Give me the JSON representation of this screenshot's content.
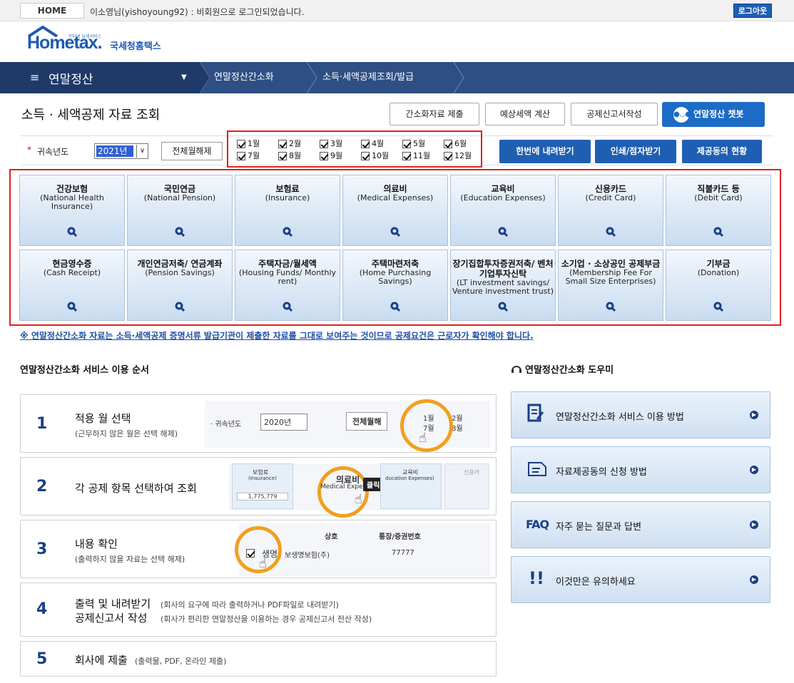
{
  "topbar": {
    "home": "HOME",
    "user_message": "이소영님(yishoyoung92) : 비회원으로 로그인되었습니다.",
    "logout": "로그아웃"
  },
  "logo": {
    "brand": "Hometax.",
    "tagline": "인터넷 납세서비스",
    "name_kr": "국세청홈택스"
  },
  "nav": {
    "menu_icon": "≡",
    "main": "연말정산",
    "crumbs": [
      "연말정산간소화",
      "소득·세액공제조회/발급"
    ]
  },
  "page": {
    "title": "소득 · 세액공제 자료 조회"
  },
  "toolbar": {
    "submit_simple": "간소화자료 제출",
    "estimate_tax": "예상세액 계산",
    "write_report": "공제신고서작성",
    "chatbot": "연말정산 챗봇",
    "chatbot_icon": "bot-icon"
  },
  "filter": {
    "year_label": "귀속년도",
    "year_value": "2021년",
    "unselect_all": "전체월해제",
    "months": [
      "1월",
      "2월",
      "3월",
      "4월",
      "5월",
      "6월",
      "7월",
      "8월",
      "9월",
      "10월",
      "11월",
      "12월"
    ],
    "download_all": "한번에 내려받기",
    "print_braille": "인쇄/점자받기",
    "provider_status": "제공동의 현황"
  },
  "items": [
    {
      "kr": "건강보험",
      "en": "(National Health Insurance)"
    },
    {
      "kr": "국민연금",
      "en": "(National Pension)"
    },
    {
      "kr": "보험료",
      "en": "(Insurance)"
    },
    {
      "kr": "의료비",
      "en": "(Medical Expenses)"
    },
    {
      "kr": "교육비",
      "en": "(Education Expenses)"
    },
    {
      "kr": "신용카드",
      "en": "(Credit Card)"
    },
    {
      "kr": "직불카드 등",
      "en": "(Debit Card)"
    },
    {
      "kr": "현금영수증",
      "en": "(Cash Receipt)"
    },
    {
      "kr": "개인연금저축/ 연금계좌",
      "en": "(Pension Savings)"
    },
    {
      "kr": "주택자금/월세액",
      "en": "(Housing Funds/ Monthly rent)"
    },
    {
      "kr": "주택마련저축",
      "en": "(Home Purchasing Savings)"
    },
    {
      "kr": "장기집합투자증권저축/ 벤처기업투자신탁",
      "en": "(LT investment savings/ Venture investment trust)"
    },
    {
      "kr": "소기업 · 소상공인 공제부금",
      "en": "(Membership Fee For Small Size Enterprises)"
    },
    {
      "kr": "기부금",
      "en": "(Donation)"
    }
  ],
  "notice": "※ 연말정산간소화 자료는 소득·세액공제 증명서류 발급기관이 제출한 자료를 그대로 보여주는 것이므로 공제요건은 근로자가 확인해야 합니다.",
  "steps_section": {
    "title": "연말정산간소화 서비스 이용 순서",
    "steps": [
      {
        "num": "1",
        "title": "적용 월 선택",
        "sub": "(근무하지 않은 월은 선택 해제)"
      },
      {
        "num": "2",
        "title": "각 공제 항목 선택하여 조회",
        "sub": ""
      },
      {
        "num": "3",
        "title": "내용 확인",
        "sub": "(출력하지 않을 자료는 선택 해제)"
      },
      {
        "num": "4",
        "title": "출력 및 내려받기",
        "sub": "(회사의 요구에 따라 출력하거나 PDF파일로 내려받기)",
        "title2": "공제신고서 작성",
        "sub2": "(회사가 편리한 연말정산을 이용하는 경우 공제신고서 전산 작성)"
      },
      {
        "num": "5",
        "title": "회사에 제출",
        "sub": "(출력물, PDF, 온라인 제출)"
      }
    ],
    "demo": {
      "year_label": "· 귀속년도",
      "year": "2020년",
      "unselect": "전체월해",
      "m1": "1월",
      "m2": "2월",
      "m7": "7월",
      "m8": "8월",
      "tile1_kr": "보험료",
      "tile1_en": "(Insurance)",
      "tile1_val": "1,775,779",
      "tile2_kr": "의료비",
      "tile2_en": "Medical Expen",
      "click": "클릭!",
      "tile3_kr": "교육비",
      "tile3_en": "ducation Expenses)",
      "tile4_kr": "신용카",
      "col1": "상호",
      "col2": "통장/증권번호",
      "row_name": "생명",
      "row_name2": "보생명보험(주)",
      "row_num": "77777"
    }
  },
  "help_section": {
    "title": "연말정산간소화 도우미",
    "items": [
      {
        "label": "연말정산간소화 서비스 이용 방법",
        "icon": "document-edit-icon"
      },
      {
        "label": "자료제공동의 신청 방법",
        "icon": "document-icon"
      },
      {
        "label": "자주 묻는 질문과 답변",
        "icon": "faq-icon",
        "icon_text": "FAQ"
      },
      {
        "label": "이것만은 유의하세요",
        "icon": "exclamation-icon",
        "icon_text": "!!"
      }
    ]
  }
}
